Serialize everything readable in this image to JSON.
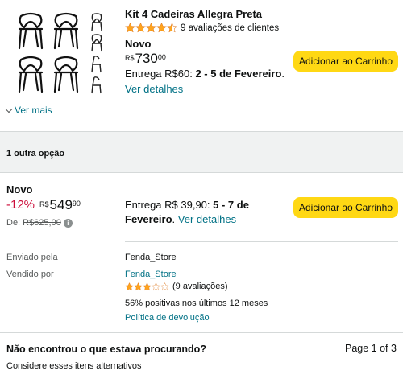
{
  "product": {
    "title": "Kit 4 Cadeiras Allegra Preta",
    "rating": 4.5,
    "rating_text": "9 avaliações de clientes",
    "condition": "Novo",
    "price_currency": "R$",
    "price_int": "730",
    "price_frac": "00",
    "shipping_prefix": "Entrega R$60: ",
    "shipping_date": "2 - 5 de Fevereiro",
    "shipping_suffix": ".",
    "details_link": "Ver detalhes",
    "add_to_cart": "Adicionar ao Carrinho",
    "see_more": "Ver mais"
  },
  "other_options": {
    "heading": "1 outra opção"
  },
  "offer": {
    "condition": "Novo",
    "discount": "-12%",
    "price_currency": "R$",
    "price_int": "549",
    "price_frac": "90",
    "was_prefix": "De: ",
    "was_price": "R$625,00",
    "shipping_prefix": "Entrega R$ 39,90: ",
    "shipping_date": "5 - 7 de Fevereiro",
    "shipping_suffix": ".",
    "details_link": "Ver detalhes",
    "add_to_cart": "Adicionar ao Carrinho",
    "shipped_by_label": "Enviado pela",
    "shipped_by_value": "Fenda_Store",
    "sold_by_label": "Vendido por",
    "sold_by_value": "Fenda_Store",
    "seller_rating": 3,
    "seller_rating_text": "(9 avaliações)",
    "positive_text": "56% positivas nos últimos 12 meses",
    "return_policy": "Política de devolução"
  },
  "footer": {
    "not_found": "Não encontrou o que estava procurando?",
    "page_indicator": "Page 1 of 3",
    "consider": "Considere esses itens alternativos"
  },
  "colors": {
    "button": "#ffd814",
    "link": "#007185",
    "discount": "#cc0c39",
    "star": "#ffa41c",
    "band": "#f0f2f2"
  }
}
